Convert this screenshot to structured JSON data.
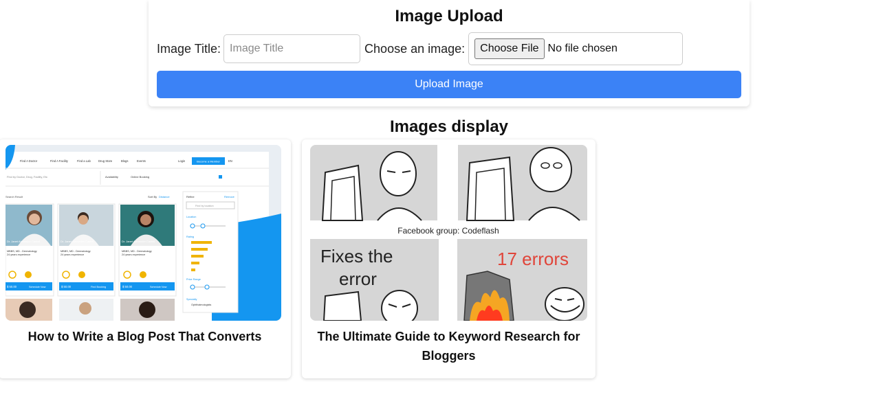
{
  "upload": {
    "title": "Image Upload",
    "image_title_label": "Image Title:",
    "image_title_placeholder": "Image Title",
    "choose_label": "Choose an image:",
    "choose_button": "Choose File",
    "file_status": "No file chosen",
    "upload_button": "Upload Image"
  },
  "display": {
    "title": "Images display",
    "cards": [
      {
        "caption": "How to Write a Blog Post That Converts",
        "thumbnail": {
          "nav": [
            "Find A Doctor",
            "Find A Facility",
            "Find a Lab",
            "Drug Store",
            "Blogs",
            "Events"
          ],
          "login": "Login",
          "cta": "Become a Member",
          "lang": "EN",
          "search_placeholder": "Find by Doctor, Drug, Facility, Etc",
          "filter_1": "Availability",
          "filter_2": "Online Booking",
          "results": "Search Result",
          "sort_label": "Sort By",
          "sort_value": "Distance",
          "doctors": [
            {
              "name": "Dr. Janet Alexander Castell",
              "spec": "MBBS, MD - Dermatology",
              "exp": "24 years experience",
              "price": "$ 50.00",
              "button": "Schedule Now"
            },
            {
              "name": "Dr. Janet Alexander Castell",
              "spec": "MBBS, MD - Dermatology",
              "exp": "24 years experience",
              "price": "$ 50.00",
              "button": "Find Booking"
            },
            {
              "name": "Dr. Janet Alexander Castell",
              "spec": "MBBS, MD - Dermatology",
              "exp": "24 years experience",
              "price": "$ 50.00",
              "button": "Schedule Now"
            }
          ],
          "refine": "Refine",
          "remove": "Remove",
          "refine_search": "Find by location",
          "location": "Location",
          "rating": "Rating",
          "price_range": "Price Range",
          "specialty": "Specialty",
          "specialty_value": "Ophthalmologists"
        }
      },
      {
        "caption": "The Ultimate Guide to Keyword Research for Bloggers",
        "thumbnail": {
          "group_text": "Facebook group: Codeflash",
          "panel_3_text": [
            "Fixes the",
            "error"
          ],
          "panel_4_text": "17 errors"
        }
      }
    ]
  },
  "colors": {
    "primary": "#3b82f6",
    "thumb_blue": "#1496f0",
    "meme_gray": "#d6d6d6",
    "error_red": "#e0453a"
  }
}
